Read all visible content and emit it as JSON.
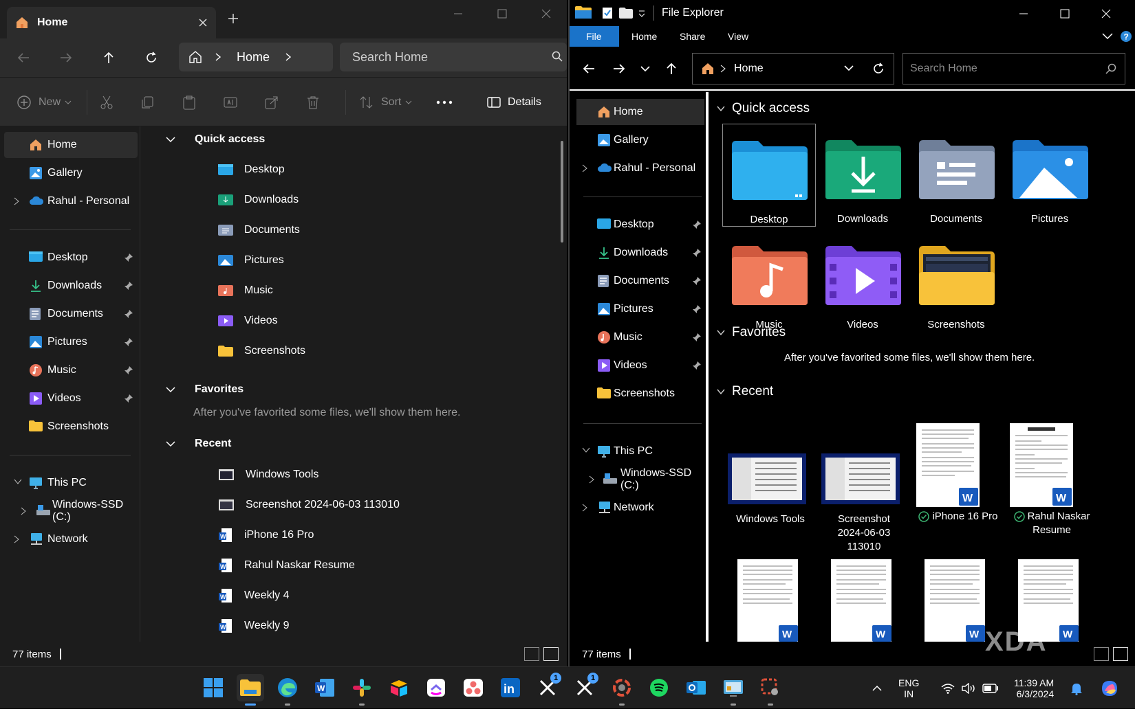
{
  "left": {
    "tab_title": "Home",
    "address": "Home",
    "search_placeholder": "Search Home",
    "commands": {
      "new": "New",
      "sort": "Sort",
      "details": "Details"
    },
    "nav": {
      "home": "Home",
      "gallery": "Gallery",
      "onedrive": "Rahul - Personal",
      "desktop": "Desktop",
      "downloads": "Downloads",
      "documents": "Documents",
      "pictures": "Pictures",
      "music": "Music",
      "videos": "Videos",
      "screenshots": "Screenshots",
      "thispc": "This PC",
      "ssd": "Windows-SSD (C:)",
      "network": "Network"
    },
    "sections": {
      "quick": "Quick access",
      "favorites": "Favorites",
      "recent": "Recent"
    },
    "quick_items": [
      "Desktop",
      "Downloads",
      "Documents",
      "Pictures",
      "Music",
      "Videos",
      "Screenshots"
    ],
    "favorites_empty": "After you've favorited some files, we'll show them here.",
    "recent_items": [
      "Windows Tools",
      "Screenshot 2024-06-03 113010",
      "iPhone 16 Pro",
      "Rahul Naskar Resume",
      "Weekly 4",
      "Weekly 9"
    ],
    "status": "77 items"
  },
  "right": {
    "title": "File Explorer",
    "ribbon": {
      "file": "File",
      "home": "Home",
      "share": "Share",
      "view": "View"
    },
    "address": "Home",
    "search_placeholder": "Search Home",
    "nav": {
      "home": "Home",
      "gallery": "Gallery",
      "onedrive": "Rahul - Personal",
      "desktop": "Desktop",
      "downloads": "Downloads",
      "documents": "Documents",
      "pictures": "Pictures",
      "music": "Music",
      "videos": "Videos",
      "screenshots": "Screenshots",
      "thispc": "This PC",
      "ssd": "Windows-SSD (C:)",
      "network": "Network"
    },
    "sections": {
      "quick": "Quick access",
      "favorites": "Favorites",
      "recent": "Recent"
    },
    "tiles": [
      "Desktop",
      "Downloads",
      "Documents",
      "Pictures",
      "Music",
      "Videos",
      "Screenshots"
    ],
    "favorites_empty": "After you've favorited some files, we'll show them here.",
    "recent": {
      "r1": "Windows Tools",
      "r2a": "Screenshot",
      "r2b": "2024-06-03",
      "r2c": "113010",
      "r3": "iPhone 16 Pro",
      "r4a": "Rahul Naskar",
      "r4b": "Resume"
    },
    "status": "77 items"
  },
  "taskbar": {
    "badges": {
      "x1": "1",
      "x2": "1"
    },
    "lang_top": "ENG",
    "lang_bottom": "IN",
    "time": "11:39 AM",
    "date": "6/3/2024"
  },
  "watermark": "XDA",
  "colors": {
    "accent": "#1a73c9",
    "folder_yellow": "#f8c23a",
    "word_blue": "#185abd",
    "spotify": "#1ed760"
  }
}
